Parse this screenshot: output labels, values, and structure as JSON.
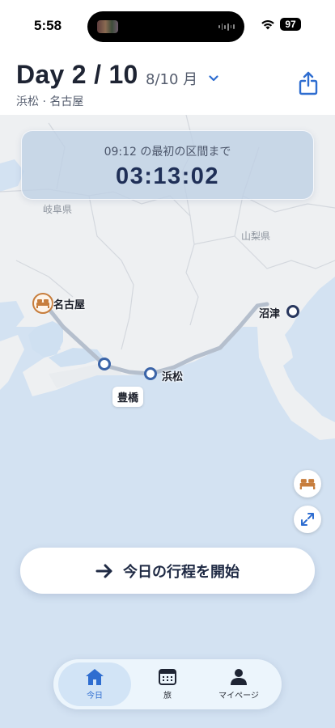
{
  "status_bar": {
    "time": "5:58",
    "battery": "97"
  },
  "header": {
    "title": "Day 2 / 10",
    "date": "8/10 月",
    "subtitle": "浜松 · 名古屋"
  },
  "countdown": {
    "caption": "09:12 の最初の区間まで",
    "time": "03:13:02"
  },
  "map": {
    "regions": [
      "岐阜県",
      "山梨県"
    ],
    "cities": {
      "nagoya": "名古屋",
      "numazu": "沼津",
      "hamamatsu": "浜松",
      "toyohashi": "豊橋"
    }
  },
  "actions": {
    "start_label": "今日の行程を開始"
  },
  "tab_bar": {
    "tabs": [
      {
        "label": "今日",
        "icon": "home-icon",
        "active": true
      },
      {
        "label": "旅",
        "icon": "calendar-icon",
        "active": false
      },
      {
        "label": "マイページ",
        "icon": "person-icon",
        "active": false
      }
    ]
  },
  "colors": {
    "accent": "#2e6dd0",
    "hotel": "#c77d3c",
    "route": "#b8c2d0"
  }
}
